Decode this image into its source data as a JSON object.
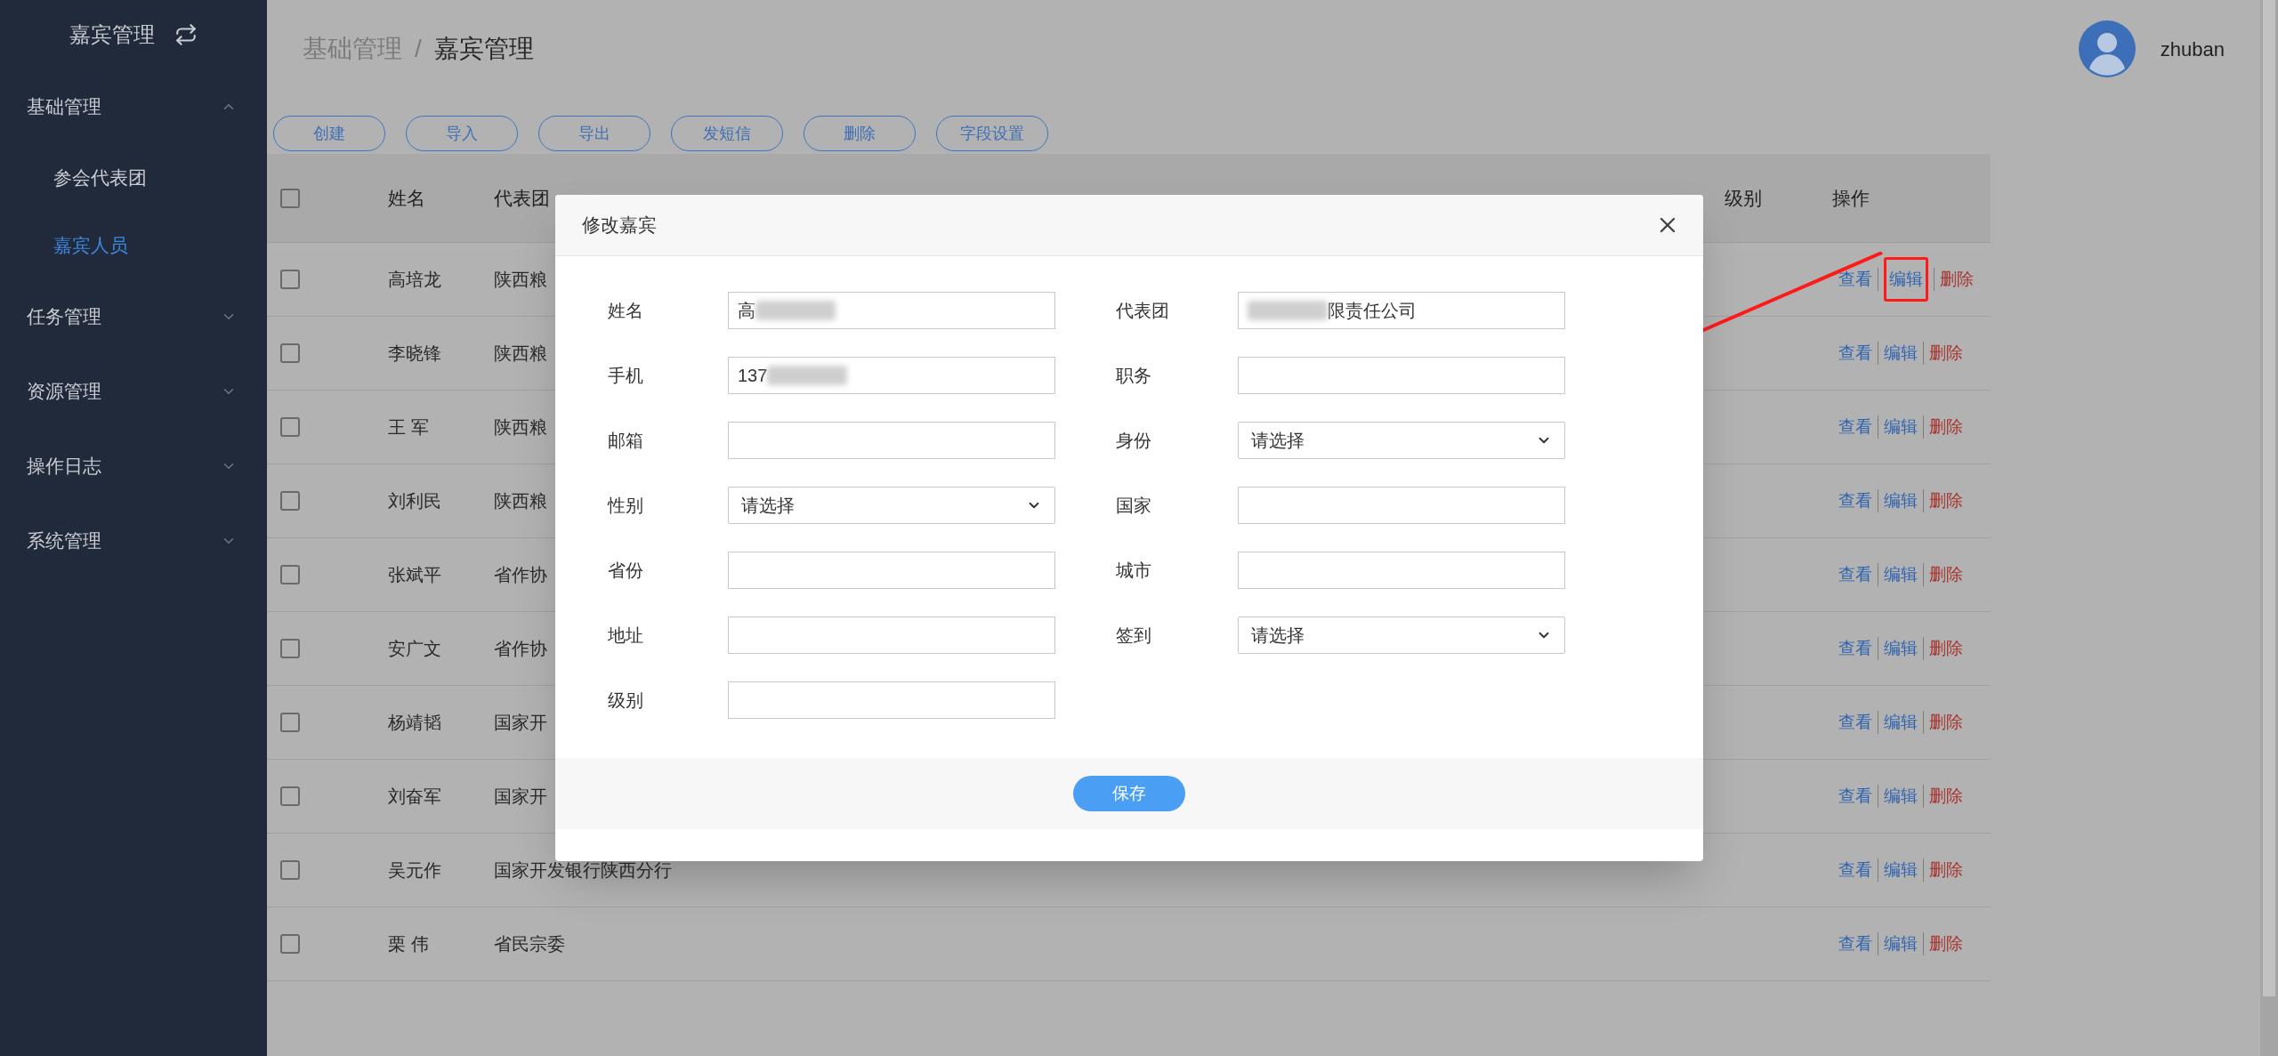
{
  "sidebar": {
    "title": "嘉宾管理",
    "menu": [
      {
        "label": "基础管理",
        "expanded": true,
        "children": [
          {
            "label": "参会代表团",
            "selected": false
          },
          {
            "label": "嘉宾人员",
            "selected": true
          }
        ]
      },
      {
        "label": "任务管理",
        "expanded": false
      },
      {
        "label": "资源管理",
        "expanded": false
      },
      {
        "label": "操作日志",
        "expanded": false
      },
      {
        "label": "系统管理",
        "expanded": false
      }
    ]
  },
  "breadcrumb": [
    "基础管理",
    "/",
    "嘉宾管理"
  ],
  "user": {
    "name": "zhuban"
  },
  "toolbar": [
    "创建",
    "导入",
    "导出",
    "发短信",
    "删除",
    "字段设置"
  ],
  "table": {
    "columns": {
      "name": "姓名",
      "delegation": "代表团",
      "level": "级别",
      "actions": "操作"
    },
    "header_checked": false,
    "rows": [
      {
        "name": "高培龙",
        "delegation": "陕西粮",
        "checked": false,
        "highlighted": true,
        "actions": [
          "查看",
          "编辑",
          "删除"
        ]
      },
      {
        "name": "李晓锋",
        "delegation": "陕西粮",
        "checked": false,
        "highlighted": false,
        "actions": [
          "查看",
          "编辑",
          "删除"
        ]
      },
      {
        "name": "王 军",
        "delegation": "陕西粮",
        "checked": false,
        "highlighted": false,
        "actions": [
          "查看",
          "编辑",
          "删除"
        ]
      },
      {
        "name": "刘利民",
        "delegation": "陕西粮",
        "checked": false,
        "highlighted": false,
        "actions": [
          "查看",
          "编辑",
          "删除"
        ]
      },
      {
        "name": "张斌平",
        "delegation": "省作协",
        "checked": false,
        "highlighted": false,
        "actions": [
          "查看",
          "编辑",
          "删除"
        ]
      },
      {
        "name": "安广文",
        "delegation": "省作协",
        "checked": false,
        "highlighted": false,
        "actions": [
          "查看",
          "编辑",
          "删除"
        ]
      },
      {
        "name": "杨靖韬",
        "delegation": "国家开",
        "checked": false,
        "highlighted": false,
        "actions": [
          "查看",
          "编辑",
          "删除"
        ]
      },
      {
        "name": "刘奋军",
        "delegation": "国家开",
        "checked": false,
        "highlighted": false,
        "actions": [
          "查看",
          "编辑",
          "删除"
        ]
      },
      {
        "name": "吴元作",
        "delegation": "国家开发银行陕西分行",
        "checked": false,
        "highlighted": false,
        "actions": [
          "查看",
          "编辑",
          "删除"
        ]
      },
      {
        "name": "栗 伟",
        "delegation": "省民宗委",
        "checked": false,
        "highlighted": false,
        "actions": [
          "查看",
          "编辑",
          "删除"
        ]
      }
    ]
  },
  "dialog": {
    "title": "修改嘉宾",
    "fields": [
      {
        "label": "姓名",
        "kind": "text",
        "value": "高",
        "blur_after": true
      },
      {
        "label": "代表团",
        "kind": "text",
        "value": "限责任公司",
        "blur_before": true
      },
      {
        "label": "手机",
        "kind": "text",
        "value": "137",
        "blur_after": true
      },
      {
        "label": "职务",
        "kind": "text"
      },
      {
        "label": "邮箱",
        "kind": "text"
      },
      {
        "label": "身份",
        "kind": "select",
        "value": "请选择"
      },
      {
        "label": "性别",
        "kind": "select",
        "value": "请选择"
      },
      {
        "label": "国家",
        "kind": "text"
      },
      {
        "label": "省份",
        "kind": "text"
      },
      {
        "label": "城市",
        "kind": "text"
      },
      {
        "label": "地址",
        "kind": "text"
      },
      {
        "label": "签到",
        "kind": "select",
        "value": "请选择"
      },
      {
        "label": "级别",
        "kind": "text"
      }
    ],
    "save_button": "保存"
  }
}
